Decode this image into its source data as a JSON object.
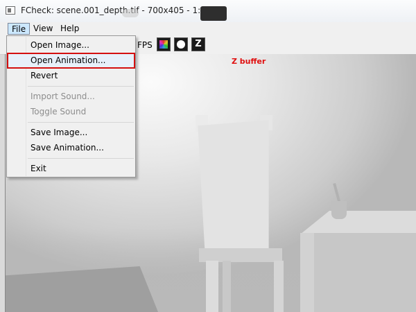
{
  "window": {
    "title": "FCheck: scene.001_depth.tif - 700x405 - 1:1"
  },
  "menubar": {
    "items": [
      {
        "label": "File"
      },
      {
        "label": "View"
      },
      {
        "label": "Help"
      }
    ]
  },
  "toolbar": {
    "fps_label": "FPS",
    "buttons": [
      {
        "icon": "rgb-channels-icon"
      },
      {
        "icon": "alpha-channel-icon"
      },
      {
        "icon": "z-buffer-icon",
        "label": "Z"
      }
    ]
  },
  "viewport": {
    "overlay_label": "Z buffer"
  },
  "file_menu": {
    "items": [
      {
        "label": "Open Image...",
        "enabled": true
      },
      {
        "label": "Open Animation...",
        "enabled": true,
        "highlighted": true
      },
      {
        "label": "Revert",
        "enabled": true
      },
      {
        "label": "Import Sound...",
        "enabled": false
      },
      {
        "label": "Toggle Sound",
        "enabled": false
      },
      {
        "label": "Save Image...",
        "enabled": true
      },
      {
        "label": "Save Animation...",
        "enabled": true
      },
      {
        "label": "Exit",
        "enabled": true
      }
    ]
  },
  "colors": {
    "highlight_border": "#d41010",
    "overlay_text": "#e01010",
    "menu_selected": "#cce8ff"
  }
}
